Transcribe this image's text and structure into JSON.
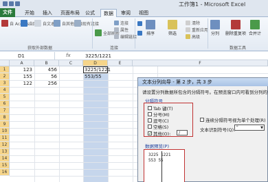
{
  "window": {
    "title": "工作簿1 - Microsoft Excel"
  },
  "ribbon_tabs": [
    "文件",
    "开始",
    "插入",
    "页面布局",
    "公式",
    "数据",
    "审阅",
    "视图"
  ],
  "active_tab": "数据",
  "ribbon": {
    "get_external": {
      "label": "获取外部数据",
      "buttons": [
        "自 Access",
        "自网站",
        "自文本",
        "自其他来源",
        "现有连接"
      ]
    },
    "connections": {
      "label": "连接",
      "buttons": [
        "全部刷新",
        "连接",
        "属性",
        "编辑链接"
      ]
    },
    "sort_filter": {
      "buttons": [
        "排序",
        "筛选",
        "清除",
        "重新应用",
        "高级"
      ]
    },
    "data_tools": {
      "label": "数据工具",
      "buttons": [
        "分列",
        "删除重复项",
        "合并计"
      ]
    }
  },
  "formula_bar": {
    "name_box": "D1",
    "fx": "fx",
    "formula": "3225/1221"
  },
  "grid": {
    "columns": [
      "A",
      "B",
      "C",
      "D",
      "E",
      "F"
    ],
    "rows": [
      "1",
      "2",
      "3",
      "4",
      "5",
      "6",
      "7",
      "8",
      "9",
      "10",
      "11",
      "12",
      "13",
      "14",
      "15",
      "16"
    ],
    "cells": {
      "A1": "123",
      "B1": "456",
      "D1": "3225/1221",
      "A2": "155",
      "B2": "56",
      "D2": "553/55",
      "A3": "122",
      "B3": "256"
    }
  },
  "dialog": {
    "title": "文本分列向导 - 第 2 步，共 3 步",
    "description": "请设置分列数据所包含的分隔符号。在预览窗口内可看到分列的效果。",
    "separator_legend": "分隔符号",
    "options": [
      {
        "label": "Tab 键(T)",
        "checked": false
      },
      {
        "label": "分号(M)",
        "checked": false
      },
      {
        "label": "逗号(C)",
        "checked": false
      },
      {
        "label": "空格(S)",
        "checked": false
      },
      {
        "label": "其他(O):",
        "checked": true
      }
    ],
    "other_value": "/",
    "consecutive_label": "连续分隔符号视为单个处理(R)",
    "qualifier_label": "文本识别符号(Q):",
    "qualifier_value": "\"",
    "preview_label": "数据预览(P)",
    "preview_lines": [
      "3225 1221",
      "553  55"
    ]
  }
}
